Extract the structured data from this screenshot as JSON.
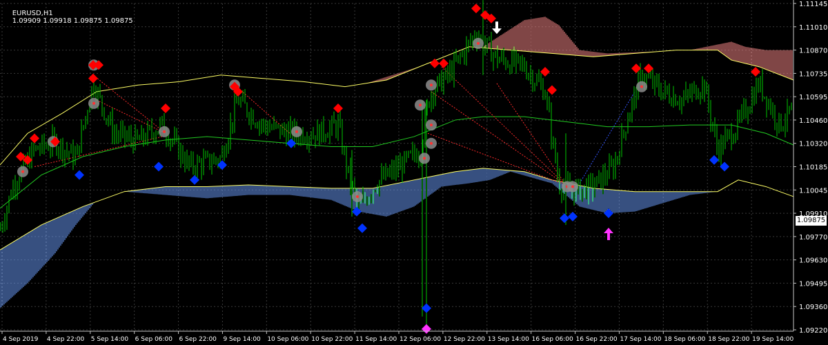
{
  "header": {
    "symbol_tf": "EURUSD,H1",
    "ohlc": "1.09909 1.09918 1.09875 1.09875"
  },
  "current_price": "1.09875",
  "colors": {
    "background": "#000000",
    "grid": "#3a3a3a",
    "axis": "#c8c8c8",
    "text": "#ffffff",
    "candles": "#00c800",
    "envelope": "#ffff66",
    "middle_line": "#22cc22",
    "cloud_up": "#ff8c8c",
    "cloud_down": "#6ea0ff",
    "sell_marker": "#ff0000",
    "buy_marker": "#0033ff",
    "signal_circle": "#8c8c8c",
    "arrow_down": "#ffffff",
    "arrow_up": "#ff33ff",
    "bottom_marker": "#ff33ff",
    "dotted_red": "#ff2a2a",
    "dotted_blue": "#3355ff"
  },
  "chart_data": {
    "type": "candlestick",
    "symbol": "EURUSD",
    "timeframe": "H1",
    "ylim": [
      1.0922,
      1.1118
    ],
    "y_ticks": [
      "1.11145",
      "1.11010",
      "1.10870",
      "1.10735",
      "1.10595",
      "1.10460",
      "1.10320",
      "1.10185",
      "1.10045",
      "1.09910",
      "1.09770",
      "1.09630",
      "1.09495",
      "1.09360",
      "1.09220"
    ],
    "x_labels": [
      "4 Sep 2019",
      "4 Sep 22:00",
      "5 Sep 14:00",
      "6 Sep 06:00",
      "6 Sep 22:00",
      "9 Sep 14:00",
      "10 Sep 06:00",
      "10 Sep 22:00",
      "11 Sep 14:00",
      "12 Sep 06:00",
      "12 Sep 22:00",
      "13 Sep 14:00",
      "16 Sep 06:00",
      "16 Sep 22:00",
      "17 Sep 14:00",
      "18 Sep 06:00",
      "18 Sep 22:00",
      "19 Sep 14:00"
    ],
    "grid": true,
    "price_key_x": [
      0,
      20,
      50,
      80,
      110,
      135,
      165,
      200,
      235,
      275,
      320,
      345,
      380,
      420,
      460,
      490,
      505,
      520,
      545,
      580,
      610,
      615,
      620,
      625,
      650,
      690,
      720,
      760,
      790,
      810,
      830,
      860,
      890,
      910,
      930,
      960,
      990,
      1020,
      1040,
      1070,
      1100,
      1130,
      1150
    ],
    "price_key_y": [
      1.0982,
      1.101,
      1.103,
      1.1035,
      1.1025,
      1.107,
      1.104,
      1.1035,
      1.1045,
      1.102,
      1.1025,
      1.106,
      1.1045,
      1.104,
      1.104,
      1.1045,
      1.1015,
      1.0995,
      1.101,
      1.102,
      1.103,
      1.1045,
      1.1058,
      1.1065,
      1.1075,
      1.11,
      1.1085,
      1.108,
      1.1065,
      1.101,
      1.1005,
      1.1008,
      1.102,
      1.105,
      1.1075,
      1.1065,
      1.106,
      1.107,
      1.103,
      1.1045,
      1.107,
      1.1045,
      1.1055
    ],
    "series": [
      {
        "kind": "upper_envelope",
        "x": [
          0,
          40,
          90,
          140,
          200,
          260,
          320,
          380,
          440,
          500,
          560,
          620,
          680,
          740,
          800,
          860,
          920,
          980,
          1040,
          1060,
          1100,
          1150
        ],
        "y": [
          1.1021,
          1.104,
          1.1052,
          1.1065,
          1.1069,
          1.1071,
          1.1075,
          1.1073,
          1.1071,
          1.1068,
          1.1072,
          1.1082,
          1.1092,
          1.109,
          1.1088,
          1.1086,
          1.1088,
          1.109,
          1.109,
          1.1084,
          1.108,
          1.1072
        ]
      },
      {
        "kind": "middle_line",
        "x": [
          0,
          60,
          120,
          180,
          240,
          300,
          360,
          420,
          480,
          540,
          600,
          660,
          700,
          760,
          820,
          880,
          940,
          1000,
          1060,
          1110,
          1150
        ],
        "y": [
          1.0995,
          1.1015,
          1.1026,
          1.1032,
          1.1036,
          1.1038,
          1.1036,
          1.1034,
          1.1032,
          1.1032,
          1.1038,
          1.1048,
          1.105,
          1.105,
          1.1047,
          1.1044,
          1.1044,
          1.1045,
          1.1045,
          1.104,
          1.1033
        ]
      },
      {
        "kind": "lower_envelope",
        "x": [
          0,
          60,
          120,
          180,
          240,
          300,
          360,
          420,
          480,
          540,
          600,
          660,
          700,
          760,
          800,
          860,
          920,
          980,
          1040,
          1070,
          1110,
          1150
        ],
        "y": [
          1.097,
          1.0985,
          1.0996,
          1.1005,
          1.1008,
          1.1008,
          1.1009,
          1.1008,
          1.1007,
          1.1007,
          1.1012,
          1.1017,
          1.1019,
          1.1017,
          1.1012,
          1.1007,
          1.1005,
          1.1005,
          1.1005,
          1.1012,
          1.1008,
          1.1002
        ]
      },
      {
        "kind": "cloud_down",
        "x": [
          0,
          40,
          80,
          110,
          140,
          180,
          240,
          300,
          360,
          420,
          480,
          520,
          560,
          600,
          640,
          680,
          710,
          740,
          800,
          840,
          880,
          920,
          960,
          1000,
          1040
        ],
        "y": [
          1.0935,
          1.095,
          1.0968,
          1.0985,
          1.1,
          1.1005,
          1.1003,
          1.1001,
          1.1003,
          1.1003,
          1.1,
          1.0993,
          1.099,
          1.0996,
          1.1008,
          1.101,
          1.1012,
          1.1017,
          1.101,
          1.0996,
          1.0992,
          1.0993,
          1.0998,
          1.1003,
          1.1005
        ]
      },
      {
        "kind": "cloud_up",
        "x": [
          380,
          420,
          460,
          500,
          530,
          700,
          730,
          760,
          790,
          810,
          840,
          880,
          1000,
          1060,
          1080,
          1110,
          1150
        ],
        "y": [
          1.1072,
          1.1067,
          1.1062,
          1.1062,
          1.107,
          1.1092,
          1.11,
          1.1108,
          1.111,
          1.1105,
          1.109,
          1.1088,
          1.109,
          1.1095,
          1.1092,
          1.109,
          1.109
        ]
      }
    ],
    "sell_markers": [
      [
        30,
        1.1026
      ],
      [
        40,
        1.1024
      ],
      [
        50,
        1.1037
      ],
      [
        80,
        1.1035
      ],
      [
        135,
        1.1073
      ],
      [
        135,
        1.1081
      ],
      [
        143,
        1.1081
      ],
      [
        240,
        1.1055
      ],
      [
        340,
        1.1068
      ],
      [
        345,
        1.1065
      ],
      [
        490,
        1.1055
      ],
      [
        630,
        1.1082
      ],
      [
        643,
        1.1082
      ],
      [
        690,
        1.1115
      ],
      [
        703,
        1.1111
      ],
      [
        712,
        1.1109
      ],
      [
        790,
        1.1077
      ],
      [
        800,
        1.1066
      ],
      [
        922,
        1.1079
      ],
      [
        940,
        1.1079
      ],
      [
        1095,
        1.1077
      ]
    ],
    "buy_markers": [
      [
        115,
        1.1015
      ],
      [
        230,
        1.102
      ],
      [
        282,
        1.1012
      ],
      [
        322,
        1.1021
      ],
      [
        422,
        1.1034
      ],
      [
        517,
        1.0993
      ],
      [
        525,
        1.0983
      ],
      [
        618,
        1.0935
      ],
      [
        818,
        1.0989
      ],
      [
        830,
        1.099
      ],
      [
        882,
        1.0992
      ],
      [
        1035,
        1.1024
      ],
      [
        1050,
        1.102
      ]
    ],
    "signal_circles": [
      [
        33,
        1.1017
      ],
      [
        77,
        1.1035
      ],
      [
        136,
        1.1081
      ],
      [
        136,
        1.1058
      ],
      [
        238,
        1.1041
      ],
      [
        340,
        1.1069
      ],
      [
        430,
        1.1041
      ],
      [
        518,
        1.1002
      ],
      [
        609,
        1.1057
      ],
      [
        625,
        1.1069
      ],
      [
        625,
        1.1045
      ],
      [
        625,
        1.1034
      ],
      [
        615,
        1.1025
      ],
      [
        693,
        1.1094
      ],
      [
        822,
        1.1008
      ],
      [
        830,
        1.1008
      ],
      [
        930,
        1.1068
      ]
    ],
    "arrow_down": [
      720,
      1.1103
    ],
    "arrow_up": [
      882,
      1.098
    ],
    "bottom_marker": [
      618,
      1.0922
    ],
    "red_dotted_lines": [
      [
        [
          135,
          1.1075
        ],
        [
          240,
          1.104
        ]
      ],
      [
        [
          140,
          1.106
        ],
        [
          240,
          1.104
        ]
      ],
      [
        [
          340,
          1.1069
        ],
        [
          420,
          1.104
        ]
      ],
      [
        [
          625,
          1.1065
        ],
        [
          820,
          1.1009
        ]
      ],
      [
        [
          640,
          1.108
        ],
        [
          820,
          1.1009
        ]
      ],
      [
        [
          720,
          1.107
        ],
        [
          820,
          1.1009
        ]
      ],
      [
        [
          620,
          1.104
        ],
        [
          820,
          1.1009
        ]
      ],
      [
        [
          50,
          1.102
        ],
        [
          235,
          1.1038
        ]
      ]
    ],
    "blue_dotted_lines": [
      [
        [
          840,
          1.101
        ],
        [
          920,
          1.1065
        ]
      ]
    ]
  }
}
